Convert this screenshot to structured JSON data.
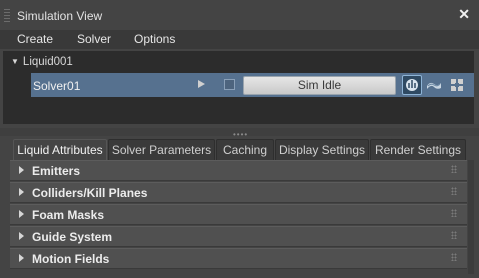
{
  "window": {
    "title": "Simulation View",
    "close_glyph": "✕"
  },
  "menu": {
    "items": [
      "Create",
      "Solver",
      "Options"
    ]
  },
  "tree": {
    "root_label": "Liquid001",
    "solver": {
      "name": "Solver01",
      "status": "Sim Idle"
    },
    "icons": [
      "play-icon",
      "enable-checkbox",
      "solver-icon",
      "wave-icon",
      "grid-icon"
    ]
  },
  "tabs": [
    "Liquid Attributes",
    "Solver Parameters",
    "Caching",
    "Display Settings",
    "Render Settings"
  ],
  "active_tab": "Liquid Attributes",
  "sections": [
    "Emitters",
    "Colliders/Kill Planes",
    "Foam Masks",
    "Guide System",
    "Motion Fields"
  ],
  "colors": {
    "selection": "#56718f",
    "background": "#444444",
    "panel": "#2c2c2c"
  }
}
